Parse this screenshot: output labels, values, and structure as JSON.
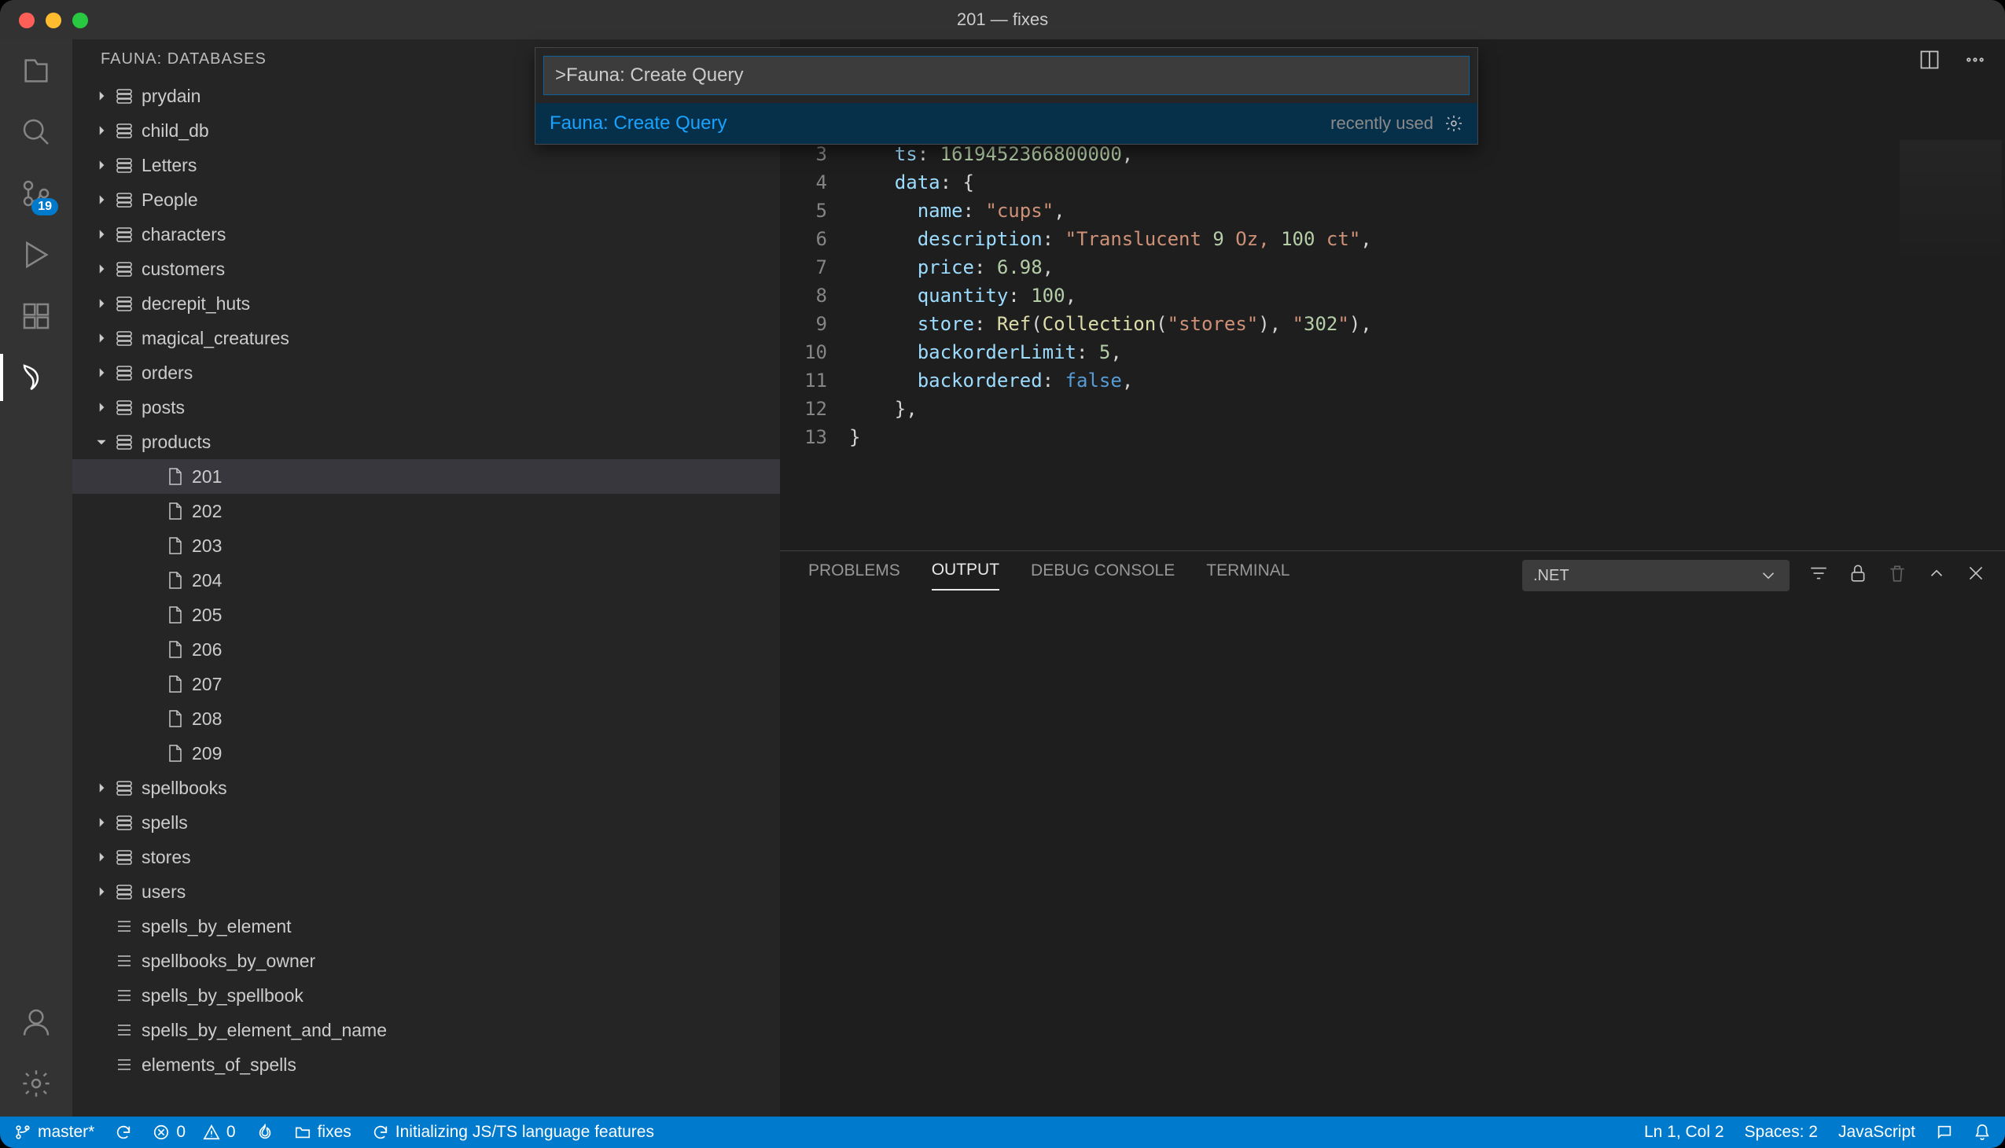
{
  "title": "201 — fixes",
  "activity": {
    "scm_badge": "19"
  },
  "sidebar": {
    "title": "FAUNA: DATABASES",
    "collections": [
      "prydain",
      "child_db",
      "Letters",
      "People",
      "characters",
      "customers",
      "decrepit_huts",
      "magical_creatures",
      "orders",
      "posts"
    ],
    "products_label": "products",
    "products": [
      "201",
      "202",
      "203",
      "204",
      "205",
      "206",
      "207",
      "208",
      "209"
    ],
    "more_collections": [
      "spellbooks",
      "spells",
      "stores",
      "users"
    ],
    "indexes": [
      "spells_by_element",
      "spellbooks_by_owner",
      "spells_by_spellbook",
      "spells_by_element_and_name",
      "elements_of_spells"
    ]
  },
  "palette": {
    "input": ">Fauna: Create Query",
    "result": "Fauna: Create Query",
    "hint": "recently used"
  },
  "editor": {
    "lines": [
      "3",
      "4",
      "5",
      "6",
      "7",
      "8",
      "9",
      "10",
      "11",
      "12",
      "13"
    ]
  },
  "code": {
    "l3": "    ts: 1619452366800000,",
    "l4": "    data: {",
    "l5": "      name: \"cups\",",
    "l6": "      description: \"Translucent 9 Oz, 100 ct\",",
    "l7": "      price: 6.98,",
    "l8": "      quantity: 100,",
    "l9": "      store: Ref(Collection(\"stores\"), \"302\"),",
    "l10": "      backorderLimit: 5,",
    "l11": "      backordered: false,",
    "l12": "    },",
    "l13": "}"
  },
  "panel": {
    "tabs": {
      "problems": "PROBLEMS",
      "output": "OUTPUT",
      "debug": "DEBUG CONSOLE",
      "terminal": "TERMINAL"
    },
    "select": ".NET"
  },
  "status": {
    "branch": "master*",
    "errors": "0",
    "warnings": "0",
    "folder": "fixes",
    "init": "Initializing JS/TS language features",
    "lncol": "Ln 1, Col 2",
    "spaces": "Spaces: 2",
    "lang": "JavaScript"
  }
}
